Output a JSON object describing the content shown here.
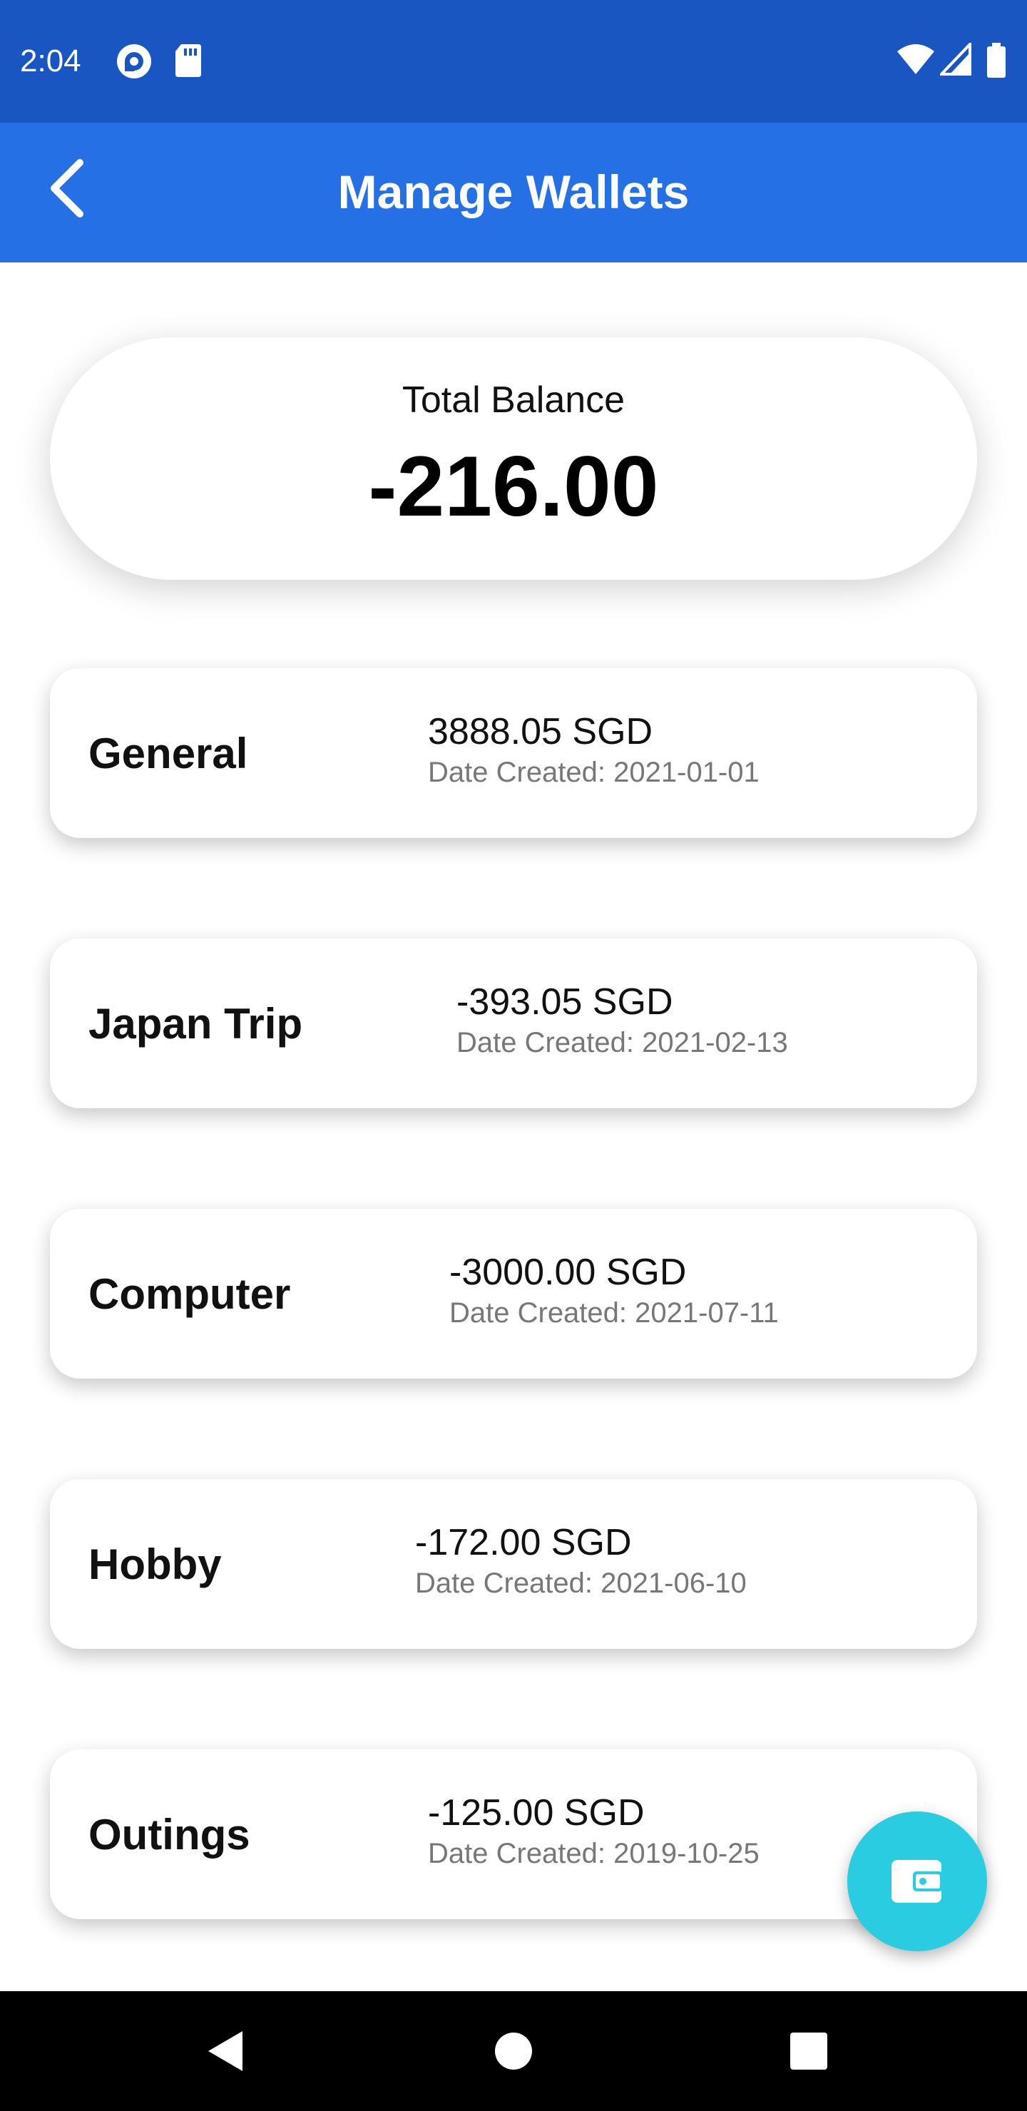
{
  "status_bar": {
    "time": "2:04",
    "icons": [
      "pocket-casts-icon",
      "sd-card-icon",
      "wifi-icon",
      "signal-icon",
      "battery-icon"
    ],
    "background": "#1a56c2"
  },
  "app_bar": {
    "title": "Manage Wallets",
    "back_icon": "chevron-left-icon",
    "background": "#2670e5"
  },
  "total": {
    "label": "Total Balance",
    "amount": "-216.00"
  },
  "wallets": [
    {
      "name": "General",
      "amount": "3888.05 SGD",
      "date": "Date Created: 2021-01-01"
    },
    {
      "name": "Japan Trip",
      "amount": "-393.05 SGD",
      "date": "Date Created: 2021-02-13"
    },
    {
      "name": "Computer",
      "amount": "-3000.00 SGD",
      "date": "Date Created: 2021-07-11"
    },
    {
      "name": "Hobby",
      "amount": "-172.00 SGD",
      "date": "Date Created: 2021-06-10"
    },
    {
      "name": "Outings",
      "amount": "-125.00 SGD",
      "date": "Date Created: 2019-10-25"
    }
  ],
  "fab": {
    "icon": "wallet-icon",
    "color": "#29cce0"
  },
  "nav_bar": {
    "icons": [
      "back-triangle-icon",
      "home-circle-icon",
      "recents-square-icon"
    ]
  }
}
